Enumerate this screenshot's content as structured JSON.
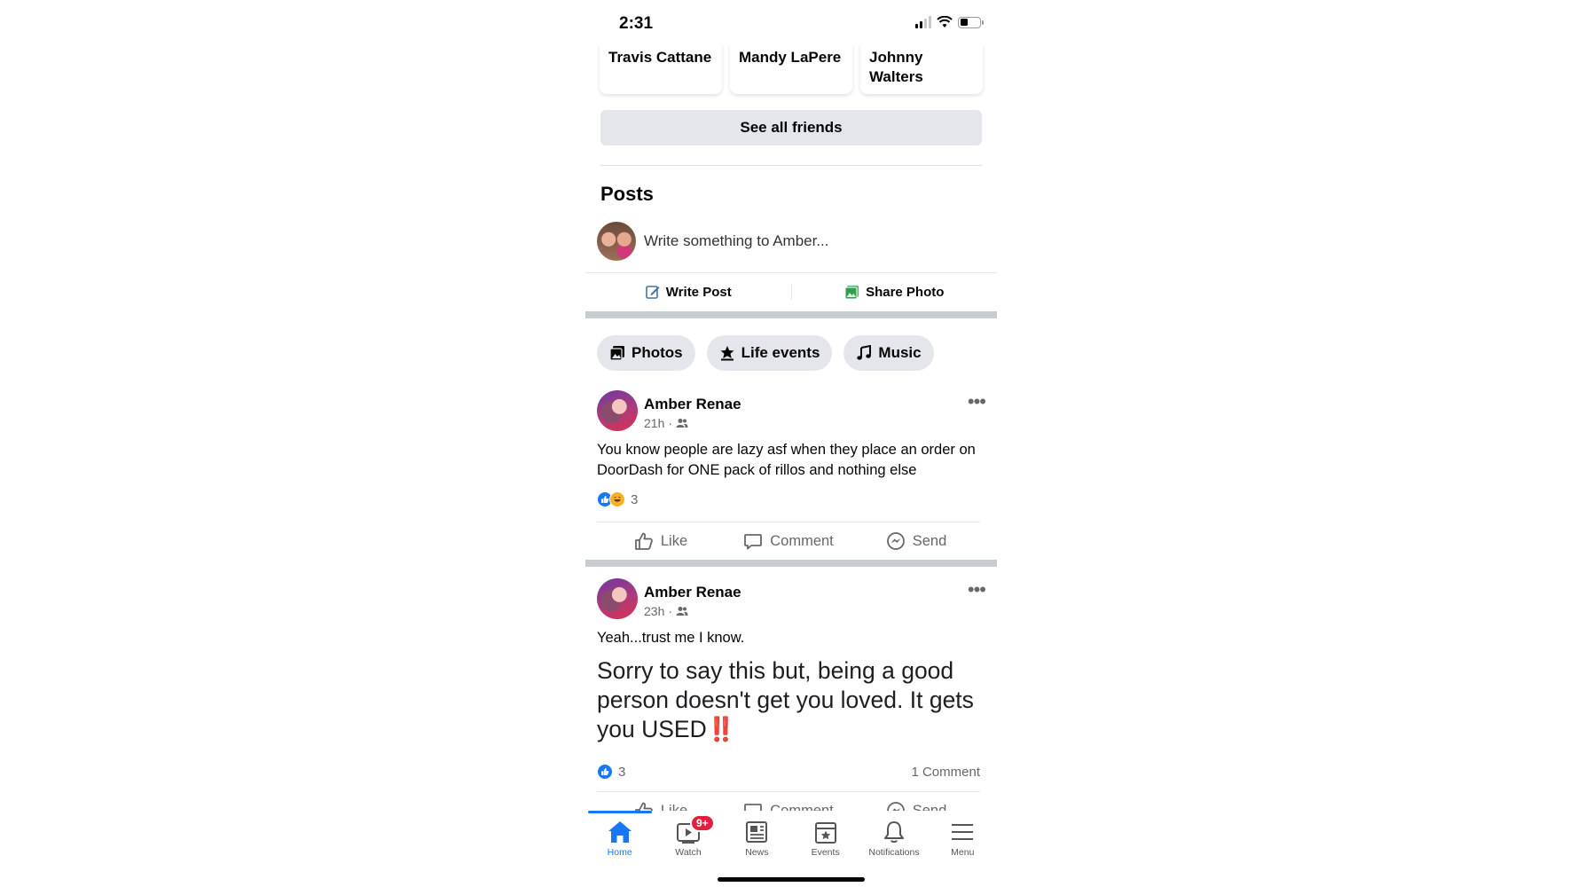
{
  "status_bar": {
    "time": "2:31"
  },
  "friends": [
    "Travis Cattane",
    "Mandy LaPere",
    "Johnny Walters"
  ],
  "see_all_label": "See all friends",
  "posts_heading": "Posts",
  "composer": {
    "placeholder": "Write something to Amber...",
    "write_post_label": "Write Post",
    "share_photo_label": "Share Photo"
  },
  "chips": [
    {
      "label": "Photos",
      "icon": "photos-icon"
    },
    {
      "label": "Life events",
      "icon": "life-events-icon"
    },
    {
      "label": "Music",
      "icon": "music-note-icon"
    }
  ],
  "posts": [
    {
      "author": "Amber Renae",
      "time": "21h",
      "audience_icon": "friends-icon",
      "text": "You know people are lazy asf when they place an order on DoorDash for ONE pack of rillos and nothing else",
      "reactions": [
        "like",
        "haha"
      ],
      "reaction_count": "3",
      "comment_count": "",
      "actions": [
        "Like",
        "Comment",
        "Send"
      ]
    },
    {
      "author": "Amber Renae",
      "time": "23h",
      "audience_icon": "friends-icon",
      "text": "Yeah...trust me I know.",
      "quote_text": "Sorry to say this but, being a good person doesn't get you loved. It gets you USED",
      "quote_emoji": "‼️",
      "reactions": [
        "like"
      ],
      "reaction_count": "3",
      "comment_count": "1 Comment",
      "actions": [
        "Like",
        "Comment",
        "Send"
      ]
    }
  ],
  "bottom_nav": [
    {
      "label": "Home",
      "icon": "home-icon",
      "active": true
    },
    {
      "label": "Watch",
      "icon": "watch-icon",
      "badge": "9+"
    },
    {
      "label": "News",
      "icon": "news-icon"
    },
    {
      "label": "Events",
      "icon": "events-icon"
    },
    {
      "label": "Notifications",
      "icon": "bell-icon"
    },
    {
      "label": "Menu",
      "icon": "menu-icon"
    }
  ],
  "colors": {
    "accent": "#1877f2",
    "badge": "#e41e3f",
    "chip_bg": "#e4e6eb"
  }
}
